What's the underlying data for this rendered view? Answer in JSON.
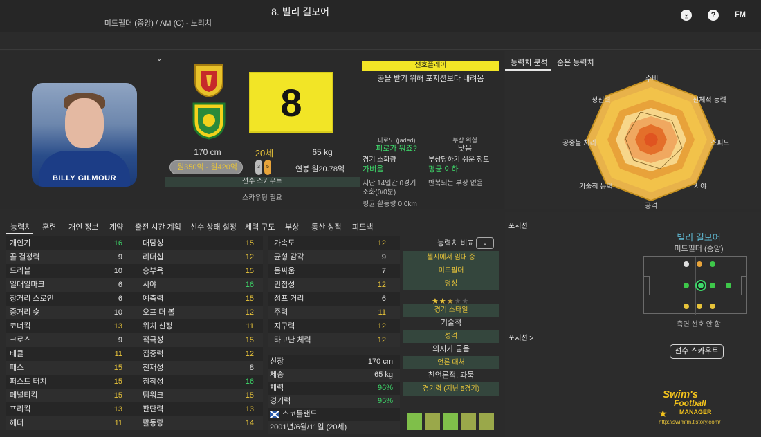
{
  "header": {
    "player_name": "8. 빌리 길모어",
    "player_role": "미드필더 (중앙) / AM (C) - 노리치",
    "icons": [
      "bulb-icon",
      "help-icon"
    ],
    "fm_logo": "FM"
  },
  "profile": {
    "photo_caption": "BILLY GILMOUR",
    "shirt_number": "8",
    "height": "170 cm",
    "age": "20세",
    "weight": "65 kg",
    "value": "원350억 - 원420억",
    "boot_left": "3",
    "boot_right": "5",
    "wage": "연봉 원20.78억",
    "scout_bar": "선수 스카우트",
    "scout_need": "스카우팅 필요"
  },
  "preferred_play": {
    "title": "선호플레이",
    "description": "공을 받기 위해 포지션보다 내려옴"
  },
  "status": {
    "fatigue_label": "피로도 (jaded)",
    "fatigue_value": "피로가 뭐죠?",
    "injury_label": "부상 위험",
    "injury_value": "낮음",
    "match_load_label": "경기 소화량",
    "match_load_value": "가벼움",
    "injury_prone_label": "부상당하기 쉬운 정도",
    "injury_prone_value": "평균 이하",
    "last14": "지난 14일간 0경기",
    "last14_sub": "소화(0/0분)",
    "recurring": "반복되는 부상 없음",
    "avg_distance": "평균 활동량 0.0km"
  },
  "right_tabs": [
    "능력치 분석",
    "숨은 능력치"
  ],
  "radar": {
    "labels": [
      "수비",
      "신체적 능력",
      "스피드",
      "시야",
      "공격",
      "기술적 능력",
      "공중볼 처리",
      "정신력"
    ]
  },
  "tabs": [
    "능력치",
    "훈련",
    "개인 정보",
    "계약",
    "출전 시간 계획",
    "선수 상태 설정",
    "세력 구도",
    "부상",
    "통산 성적",
    "피드백"
  ],
  "technical": [
    {
      "name": "개인기",
      "value": "16",
      "color": "green"
    },
    {
      "name": "골 결정력",
      "value": "9",
      "color": "white"
    },
    {
      "name": "드리블",
      "value": "10",
      "color": "white"
    },
    {
      "name": "일대일마크",
      "value": "6",
      "color": "white"
    },
    {
      "name": "장거리 스로인",
      "value": "6",
      "color": "white"
    },
    {
      "name": "중거리 슛",
      "value": "10",
      "color": "white"
    },
    {
      "name": "코너킥",
      "value": "13",
      "color": "yellow"
    },
    {
      "name": "크로스",
      "value": "9",
      "color": "white"
    },
    {
      "name": "태클",
      "value": "11",
      "color": "yellow"
    },
    {
      "name": "패스",
      "value": "15",
      "color": "yellow"
    },
    {
      "name": "퍼스트 터치",
      "value": "15",
      "color": "yellow"
    },
    {
      "name": "페널티킥",
      "value": "15",
      "color": "yellow"
    },
    {
      "name": "프리킥",
      "value": "13",
      "color": "yellow"
    },
    {
      "name": "헤더",
      "value": "11",
      "color": "yellow"
    }
  ],
  "mental": [
    {
      "name": "대담성",
      "value": "15",
      "color": "yellow"
    },
    {
      "name": "리더십",
      "value": "12",
      "color": "yellow"
    },
    {
      "name": "승부욕",
      "value": "15",
      "color": "yellow"
    },
    {
      "name": "시야",
      "value": "16",
      "color": "green"
    },
    {
      "name": "예측력",
      "value": "15",
      "color": "yellow"
    },
    {
      "name": "오프 더 볼",
      "value": "12",
      "color": "yellow"
    },
    {
      "name": "위치 선정",
      "value": "11",
      "color": "yellow"
    },
    {
      "name": "적극성",
      "value": "15",
      "color": "yellow"
    },
    {
      "name": "집중력",
      "value": "12",
      "color": "yellow"
    },
    {
      "name": "천재성",
      "value": "8",
      "color": "white"
    },
    {
      "name": "침착성",
      "value": "16",
      "color": "green"
    },
    {
      "name": "팀워크",
      "value": "15",
      "color": "yellow"
    },
    {
      "name": "판단력",
      "value": "13",
      "color": "yellow"
    },
    {
      "name": "활동량",
      "value": "14",
      "color": "yellow"
    }
  ],
  "physical": [
    {
      "name": "가속도",
      "value": "12",
      "color": "yellow"
    },
    {
      "name": "균형 감각",
      "value": "9",
      "color": "white"
    },
    {
      "name": "몸싸움",
      "value": "7",
      "color": "white"
    },
    {
      "name": "민첩성",
      "value": "12",
      "color": "yellow"
    },
    {
      "name": "점프 거리",
      "value": "6",
      "color": "white"
    },
    {
      "name": "주력",
      "value": "11",
      "color": "yellow"
    },
    {
      "name": "지구력",
      "value": "12",
      "color": "yellow"
    },
    {
      "name": "타고난 체력",
      "value": "12",
      "color": "yellow"
    }
  ],
  "info_table": [
    {
      "label": "신장",
      "value": "170 cm",
      "color": "white"
    },
    {
      "label": "체중",
      "value": "65 kg",
      "color": "white"
    },
    {
      "label": "체력",
      "value": "96%",
      "color": "green"
    },
    {
      "label": "경기력",
      "value": "95%",
      "color": "green"
    },
    {
      "label": "스코틀랜드",
      "value": "",
      "color": "white"
    },
    {
      "label": "2001년/6월/11일 (20세)",
      "value": "",
      "color": "white"
    }
  ],
  "compare": {
    "title": "능력치 비교",
    "rows": [
      {
        "text": "첼시에서 임대 중",
        "kind": "band"
      },
      {
        "text": "미드필더",
        "kind": "band"
      },
      {
        "text": "명성",
        "kind": "band"
      },
      {
        "text": "",
        "kind": "stars"
      },
      {
        "text": "경기 스타일",
        "kind": "band"
      },
      {
        "text": "기술적",
        "kind": "plain"
      },
      {
        "text": "성격",
        "kind": "band"
      },
      {
        "text": "의지가 굳음",
        "kind": "plain"
      },
      {
        "text": "언론 대처",
        "kind": "band"
      },
      {
        "text": "친언론적, 과묵",
        "kind": "plain"
      },
      {
        "text": "경기력 (지난 5경기)",
        "kind": "band"
      }
    ],
    "stars_filled": 2.5,
    "stars_total": 5
  },
  "positions": {
    "section_label": "포지션",
    "section_label2": "포지션 >",
    "name": "빌리 길모어",
    "role": "미드필더 (중앙)",
    "note": "측면 선호 안 함",
    "scout_button": "선수 스카우트"
  },
  "watermark": {
    "line1": "Swim's",
    "line2": "Football",
    "line3": "MANAGER",
    "url": "http://swimfm.tistory.com/"
  },
  "colors": {
    "accent_yellow": "#f2e526",
    "value_green": "#3ed86a",
    "value_yellow": "#e8c43a",
    "name_blue": "#5fb7d0"
  }
}
